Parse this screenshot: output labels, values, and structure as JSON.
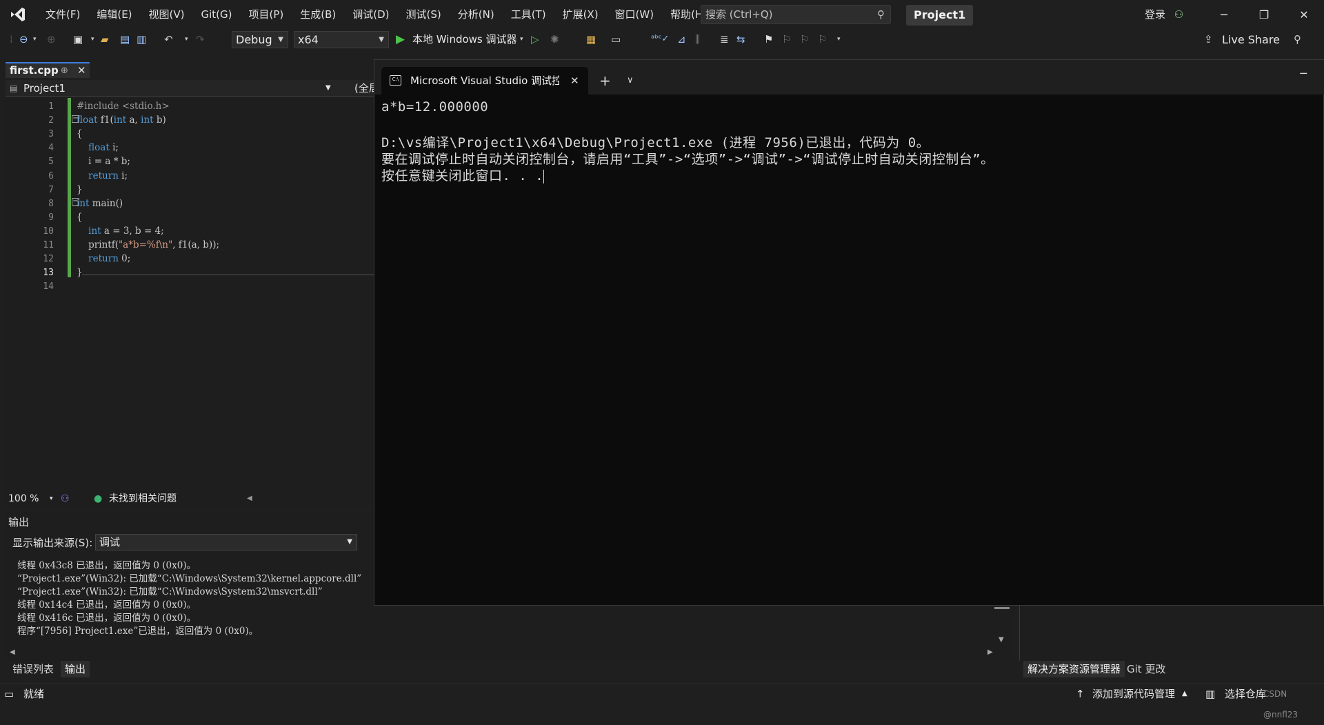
{
  "menu": [
    "文件(F)",
    "编辑(E)",
    "视图(V)",
    "Git(G)",
    "项目(P)",
    "生成(B)",
    "调试(D)",
    "测试(S)",
    "分析(N)",
    "工具(T)",
    "扩展(X)",
    "窗口(W)",
    "帮助(H)"
  ],
  "search": {
    "placeholder": "搜索 (Ctrl+Q)"
  },
  "project_title": "Project1",
  "login_label": "登录",
  "toolbar": {
    "config": "Debug",
    "platform": "x64",
    "run_label": "本地 Windows 调试器",
    "live_share": "Live Share"
  },
  "editor": {
    "tab_label": "first.cpp",
    "nav_project": "Project1",
    "nav_scope": "(全局",
    "zoom": "100 %",
    "issues": "未找到相关问题",
    "current_line": 13,
    "lines": [
      {
        "num": "1",
        "text": "#include <stdio.h>"
      },
      {
        "num": "2",
        "text": "float f1(int a, int b)"
      },
      {
        "num": "3",
        "text": "{"
      },
      {
        "num": "4",
        "text": "    float i;"
      },
      {
        "num": "5",
        "text": "    i = a * b;"
      },
      {
        "num": "6",
        "text": "    return i;"
      },
      {
        "num": "7",
        "text": "}"
      },
      {
        "num": "8",
        "text": "int main()"
      },
      {
        "num": "9",
        "text": "{"
      },
      {
        "num": "10",
        "text": "    int a = 3, b = 4;"
      },
      {
        "num": "11",
        "text": "    printf(\"a*b=%f\\n\", f1(a, b));"
      },
      {
        "num": "12",
        "text": "    return 0;"
      },
      {
        "num": "13",
        "text": "}"
      },
      {
        "num": "14",
        "text": ""
      }
    ]
  },
  "output": {
    "title": "输出",
    "source_label": "显示输出来源(S):",
    "source_value": "调试",
    "lines": [
      "线程 0x43c8 已退出，返回值为 0 (0x0)。",
      "“Project1.exe”(Win32): 已加载“C:\\Windows\\System32\\kernel.appcore.dll”",
      "“Project1.exe”(Win32): 已加载“C:\\Windows\\System32\\msvcrt.dll”",
      "线程 0x14c4 已退出，返回值为 0 (0x0)。",
      "线程 0x416c 已退出，返回值为 0 (0x0)。",
      "程序“[7956] Project1.exe”已退出，返回值为 0 (0x0)。"
    ]
  },
  "bottom_tabs": [
    "错误列表",
    "输出"
  ],
  "right_tabs": [
    "解决方案资源管理器",
    "Git 更改"
  ],
  "status": {
    "ready": "就绪",
    "add_source": "添加到源代码管理",
    "select_repo": "选择仓库",
    "watermark": "CSDN @nnfl23"
  },
  "console": {
    "tab_title": "Microsoft Visual Studio 调试控制台",
    "lines": [
      "a*b=12.000000",
      "",
      "D:\\vs编译\\Project1\\x64\\Debug\\Project1.exe (进程 7956)已退出，代码为 0。",
      "要在调试停止时自动关闭控制台，请启用“工具”->“选项”->“调试”->“调试停止时自动关闭控制台”。",
      "按任意键关闭此窗口. . ."
    ]
  }
}
